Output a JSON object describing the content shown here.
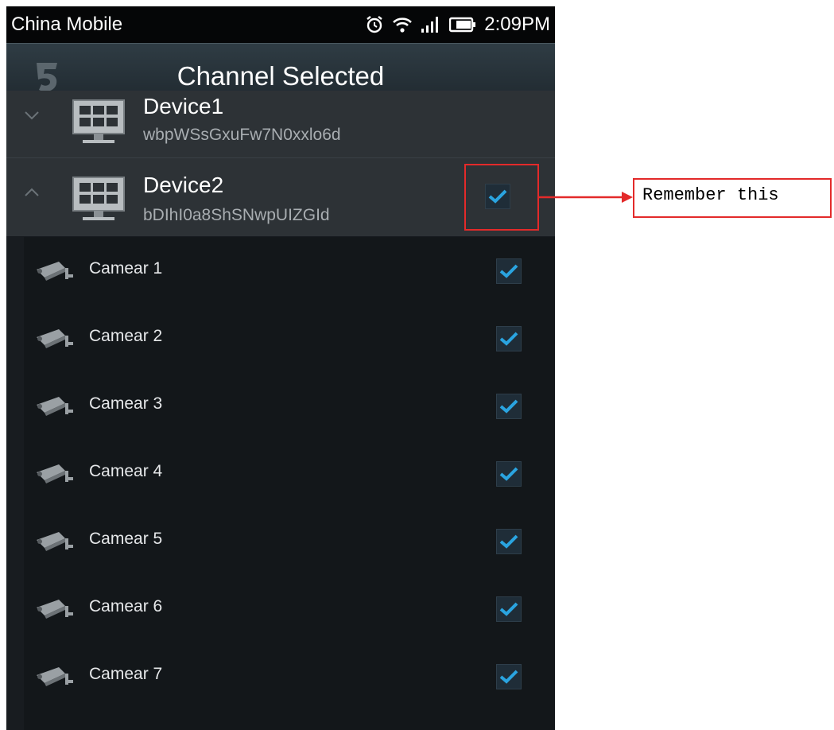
{
  "status_bar": {
    "carrier": "China Mobile",
    "time": "2:09PM",
    "icons": [
      "alarm-icon",
      "wifi-icon",
      "signal-icon",
      "battery-icon"
    ]
  },
  "header": {
    "title": "Channel Selected",
    "logo_icon": "app-logo-icon"
  },
  "devices": [
    {
      "name": "Device1",
      "serial": "wbpWSsGxuFw7N0xxlo6d",
      "expanded": false
    },
    {
      "name": "Device2",
      "serial": "bDIhI0a8ShSNwpUIZGId",
      "expanded": true,
      "checked": true
    }
  ],
  "cameras": [
    {
      "label": "Camear 1",
      "checked": true
    },
    {
      "label": "Camear 2",
      "checked": true
    },
    {
      "label": "Camear 3",
      "checked": true
    },
    {
      "label": "Camear 4",
      "checked": true
    },
    {
      "label": "Camear 5",
      "checked": true
    },
    {
      "label": "Camear 6",
      "checked": true
    },
    {
      "label": "Camear 7",
      "checked": true
    }
  ],
  "annotation": {
    "callout_text": "Remember this"
  },
  "colors": {
    "check_accent": "#2aa4e0",
    "highlight": "#e32a2a"
  }
}
